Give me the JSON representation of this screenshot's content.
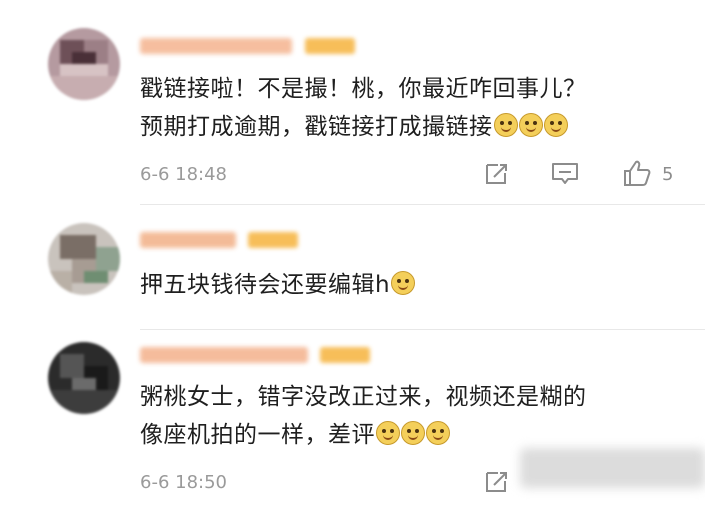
{
  "comments": [
    {
      "text_lines": [
        "戳链接啦！不是撮！桃，你最近咋回事儿？",
        "预期打成逾期，戳链接打成撮链接"
      ],
      "emoji_count": 3,
      "time": "6-6 18:48",
      "like_count": "5"
    },
    {
      "text_lines": [
        "押五块钱待会还要编辑h"
      ],
      "emoji_count": 1
    },
    {
      "text_lines": [
        "粥桃女士，错字没改正过来，视频还是糊的",
        "像座机拍的一样，差评"
      ],
      "emoji_count": 3,
      "time": "6-6 18:50"
    }
  ],
  "icons": {
    "repost": "repost-icon",
    "reply": "comment-icon",
    "like": "thumbs-up-icon"
  },
  "colors": {
    "text": "#1f1f1f",
    "meta": "#9a9a9a",
    "badge": "#f6b33d"
  }
}
